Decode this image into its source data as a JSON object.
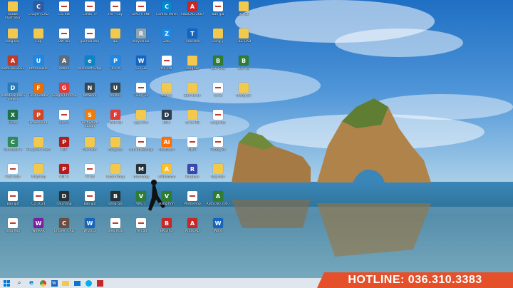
{
  "hotline": "HOTLINE: 036.310.3383",
  "colors": {
    "accent": "#e4502a",
    "sky": "#2f7fd0",
    "sea": "#1c6f9a",
    "taskbar": "#dfe6ee"
  },
  "taskbar": {
    "start": "windows-logo",
    "search": "search",
    "items": [
      "edge",
      "chrome",
      "word",
      "explorer",
      "mail",
      "skype",
      "zalo"
    ]
  },
  "icons": [
    {
      "label": "Adobe Illustrator",
      "type": "folder"
    },
    {
      "label": "tang key",
      "type": "folder"
    },
    {
      "label": "AutoCAD 2021",
      "type": "app",
      "color": "#c0392b",
      "glyph": "A"
    },
    {
      "label": "Autodesk DWG Viewer",
      "type": "app",
      "color": "#2c7bb6",
      "glyph": "D"
    },
    {
      "label": "Excel",
      "type": "app",
      "color": "#1e7145",
      "glyph": "X"
    },
    {
      "label": "Camtasia 9",
      "type": "app",
      "color": "#2e8b57",
      "glyph": "C"
    },
    {
      "label": "FILE CAD",
      "type": "doc"
    },
    {
      "label": "Bao gia",
      "type": "doc"
    },
    {
      "label": "tong hop",
      "type": "doc"
    },
    {
      "label": "Chuyen CAD",
      "type": "app",
      "color": "#2d5aa0",
      "glyph": "C"
    },
    {
      "label": "Cop",
      "type": "folder"
    },
    {
      "label": "UltraViewer",
      "type": "app",
      "color": "#1e88e5",
      "glyph": "U"
    },
    {
      "label": "Foxit Reader",
      "type": "app",
      "color": "#ef6c00",
      "glyph": "F"
    },
    {
      "label": "PowerPoint",
      "type": "app",
      "color": "#d24726",
      "glyph": "P"
    },
    {
      "label": "File phan mem",
      "type": "folder"
    },
    {
      "label": "Tong hop",
      "type": "folder"
    },
    {
      "label": "CD 2021",
      "type": "doc"
    },
    {
      "label": "WinRAR",
      "type": "app",
      "color": "#7b1fa2",
      "glyph": "W"
    },
    {
      "label": "Cai dat",
      "type": "doc"
    },
    {
      "label": "BW dai",
      "type": "doc"
    },
    {
      "label": "Admin",
      "type": "app",
      "color": "#5d6d7e",
      "glyph": "A"
    },
    {
      "label": "Google Chrome",
      "type": "app",
      "color": "#e53935",
      "glyph": "G"
    },
    {
      "label": "Cad 1",
      "type": "doc"
    },
    {
      "label": "PDF",
      "type": "app",
      "color": "#b71c1c",
      "glyph": "P"
    },
    {
      "label": "PDF 1",
      "type": "app",
      "color": "#b71c1c",
      "glyph": "P"
    },
    {
      "label": "dau hang",
      "type": "app",
      "color": "#263238",
      "glyph": "D"
    },
    {
      "label": "Chuyen CAD",
      "type": "app",
      "color": "#6d4c41",
      "glyph": "C"
    },
    {
      "label": "CONG TY",
      "type": "doc"
    },
    {
      "label": "gia hoa don",
      "type": "doc"
    },
    {
      "label": "Microsoft Edge",
      "type": "app",
      "color": "#0a84c6",
      "glyph": "e"
    },
    {
      "label": "Network",
      "type": "app",
      "color": "#37474f",
      "glyph": "N"
    },
    {
      "label": "TechSmith Snagit",
      "type": "app",
      "color": "#f57c00",
      "glyph": "S"
    },
    {
      "label": "Cac dinh",
      "type": "folder"
    },
    {
      "label": "TT 10",
      "type": "doc"
    },
    {
      "label": "Bao gia",
      "type": "doc"
    },
    {
      "label": "W 2013",
      "type": "app",
      "color": "#1565c0",
      "glyph": "W"
    },
    {
      "label": "HD - Cay",
      "type": "doc"
    },
    {
      "label": "qui",
      "type": "folder"
    },
    {
      "label": "This PC",
      "type": "app",
      "color": "#1e88e5",
      "glyph": "P"
    },
    {
      "label": "UniKey",
      "type": "app",
      "color": "#37474f",
      "glyph": "U"
    },
    {
      "label": "Foxit 3D",
      "type": "app",
      "color": "#e53935",
      "glyph": "F"
    },
    {
      "label": "cong bac",
      "type": "folder"
    },
    {
      "label": "Nhan Cong",
      "type": "folder"
    },
    {
      "label": "bang gia",
      "type": "app",
      "color": "#263238",
      "glyph": "B"
    },
    {
      "label": "Bieu mau",
      "type": "doc"
    },
    {
      "label": "GIAO TRINH",
      "type": "doc"
    },
    {
      "label": "Recycle Bin",
      "type": "app",
      "color": "#90a4ae",
      "glyph": "R"
    },
    {
      "label": "52T 32",
      "type": "app",
      "color": "#1565c0",
      "glyph": "W"
    },
    {
      "label": "Tieng Tui",
      "type": "doc"
    },
    {
      "label": "quy dinh",
      "type": "folder"
    },
    {
      "label": "anh Photoshop",
      "type": "doc"
    },
    {
      "label": "mat hang",
      "type": "app",
      "color": "#263238",
      "glyph": "M"
    },
    {
      "label": "VNC 1",
      "type": "app",
      "color": "#2e7d32",
      "glyph": "V"
    },
    {
      "label": "file cad",
      "type": "doc"
    },
    {
      "label": "Control Panel",
      "type": "app",
      "color": "#0288d1",
      "glyph": "C"
    },
    {
      "label": "Zalo",
      "type": "app",
      "color": "#1e88e5",
      "glyph": "Z"
    },
    {
      "label": "file PDF",
      "type": "doc"
    },
    {
      "label": "ban ve",
      "type": "folder"
    },
    {
      "label": "DOC",
      "type": "app",
      "color": "#2c3e50",
      "glyph": "D"
    },
    {
      "label": "Illustrator",
      "type": "app",
      "color": "#ff6f00",
      "glyph": "Ai"
    },
    {
      "label": "N Shortcut",
      "type": "app",
      "color": "#fbc02d",
      "glyph": "A"
    },
    {
      "label": "Bang tinh",
      "type": "app",
      "color": "#2e7d32",
      "glyph": "V"
    },
    {
      "label": "BKGTAX",
      "type": "app",
      "color": "#c62828",
      "glyph": "B"
    },
    {
      "label": "AutoCAD 2007",
      "type": "app",
      "color": "#c62828",
      "glyph": "A"
    },
    {
      "label": "Translate",
      "type": "app",
      "color": "#1565c0",
      "glyph": "T"
    },
    {
      "label": "cong tac",
      "type": "folder"
    },
    {
      "label": "Ban du an",
      "type": "folder"
    },
    {
      "label": "ra ve HD",
      "type": "folder"
    },
    {
      "label": "QLCP",
      "type": "doc"
    },
    {
      "label": "Ra phan",
      "type": "app",
      "color": "#3949ab",
      "glyph": "R"
    },
    {
      "label": "Photoshop",
      "type": "doc"
    },
    {
      "label": "AutoCAD",
      "type": "app",
      "color": "#c62828",
      "glyph": "A"
    },
    {
      "label": "Bao gia",
      "type": "doc"
    },
    {
      "label": "Song y",
      "type": "folder"
    },
    {
      "label": "ban CAD",
      "type": "app",
      "color": "#2e7d32",
      "glyph": "B"
    },
    {
      "label": "ra ve",
      "type": "doc"
    },
    {
      "label": "tong hop",
      "type": "doc"
    },
    {
      "label": "Thong ke",
      "type": "doc"
    },
    {
      "label": "Quy don",
      "type": "folder"
    },
    {
      "label": "AutoCAD 2007",
      "type": "app",
      "color": "#2e7d32",
      "glyph": "A"
    },
    {
      "label": "Word",
      "type": "app",
      "color": "#1565c0",
      "glyph": "W"
    },
    {
      "label": "DO DE",
      "type": "folder"
    },
    {
      "label": "FILE CAD",
      "type": "folder"
    },
    {
      "label": "Ban da",
      "type": "app",
      "color": "#2e7d32",
      "glyph": "B"
    },
    {
      "label": "thong tin",
      "type": "folder"
    }
  ]
}
